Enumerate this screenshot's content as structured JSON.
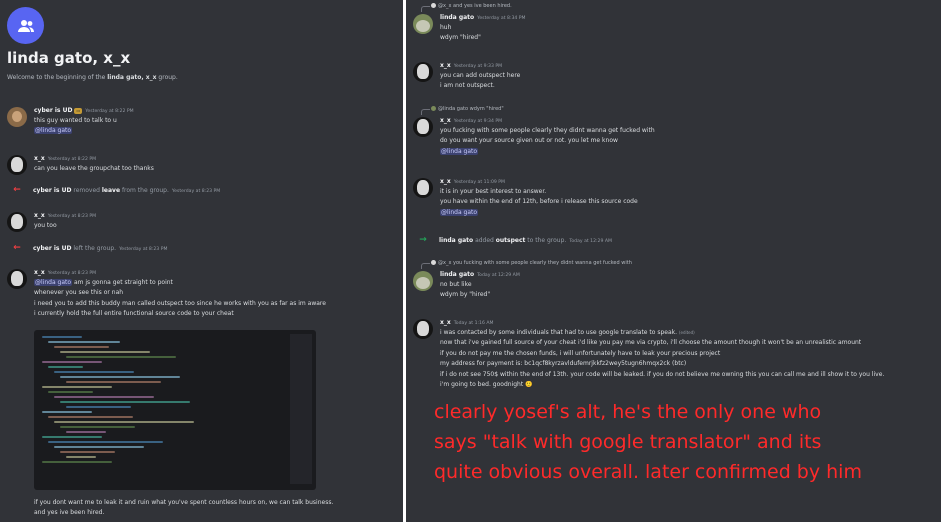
{
  "group": {
    "title": "linda gato, x_x",
    "welcome_prefix": "Welcome to the beginning of the ",
    "welcome_name": "linda gato, x_x",
    "welcome_suffix": " group."
  },
  "left_messages": [
    {
      "author": "cyber is UD",
      "tag": "▭",
      "time": "Yesterday at 8:22 PM",
      "lines": [
        "this guy wanted to talk to u"
      ],
      "mention": "@linda gato"
    },
    {
      "author": "x_x",
      "time": "Yesterday at 8:22 PM",
      "lines": [
        "can you leave the groupchat too thanks"
      ]
    },
    {
      "author": "x_x",
      "time": "Yesterday at 8:23 PM",
      "lines": [
        "you too"
      ]
    },
    {
      "author": "x_x",
      "time": "Yesterday at 8:23 PM",
      "mention": "@linda gato",
      "lines": [
        " am js gonna get straight to point",
        "whenever you see this or nah",
        "i need you to add this buddy man called outspect too since he works with you as far as im aware",
        "i currently hold the full entire functional source code to your cheat"
      ],
      "after": [
        "if you dont want me to leak it and ruin what you've spent countless hours on, we can talk business.",
        "and yes ive been hired."
      ]
    }
  ],
  "left_system": [
    {
      "name": "cyber is UD",
      "text1": " removed ",
      "strong": "leave",
      "text2": " from the group.",
      "time": "Yesterday at 8:23 PM"
    },
    {
      "name": "cyber is UD",
      "text1": " left the group.",
      "time": "Yesterday at 8:23 PM"
    }
  ],
  "right_messages": [
    {
      "reply": "@x_x and yes ive been hired.",
      "author": "linda gato",
      "time": "Yesterday at 8:34 PM",
      "lines": [
        "huh",
        "wdym \"hired\""
      ]
    },
    {
      "author": "x_x",
      "time": "Yesterday at 9:33 PM",
      "lines": [
        "you can add outspect here",
        "i am not outspect."
      ]
    },
    {
      "reply": "@linda gato wdym \"hired\"",
      "author": "x_x",
      "time": "Yesterday at 9:34 PM",
      "lines": [
        "you fucking with some people clearly they didnt wanna get fucked with",
        "do you want your source given out or not. you let me know"
      ],
      "mention": "@linda gato"
    },
    {
      "author": "x_x",
      "time": "Yesterday at 11:09 PM",
      "lines": [
        "it is in your best interest to answer.",
        "you have within the end of 12th, before i release this source code"
      ],
      "mention": "@linda gato"
    },
    {
      "reply": "@x_x you fucking with some people clearly they didnt wanna get fucked with",
      "author": "linda gato",
      "time": "Today at 12:29 AM",
      "lines": [
        "no but like",
        "wdym by \"hired\""
      ]
    },
    {
      "author": "x_x",
      "time": "Today at 1:16 AM",
      "lines": [
        "i was contacted by some individuals that had to use google translate to speak.",
        "now that i've gained full source of your cheat i'd like you pay me via crypto, i'll choose the amount though it won't be an unrealistic amount",
        "if you do not pay me the chosen funds, i will unfortunately have to leak your precious project",
        "my address for payment is: bc1qcf8kyrzavldufemrjkkfz2wey5tugn6hmqx2ck (btc)",
        "if i do not see 750$ within the end of 13th. your code will be leaked. if you do not believe me owning this you can call me and ill show it to you live.",
        "i'm going to bed. goodnight 🙂"
      ],
      "edited": "(edited)"
    }
  ],
  "right_system": {
    "name": "linda gato",
    "text1": " added ",
    "strong": "outspect",
    "text2": " to the group.",
    "time": "Today at 12:29 AM"
  },
  "caption": [
    "clearly yosef's alt, he's the only one who",
    "says \"talk with google translator\" and its",
    "quite obvious overall. later confirmed by him"
  ],
  "colors": {
    "background": "#313338",
    "mention_bg": "#3c4270",
    "caption": "#ff2a2a",
    "leave_arrow": "#f23f42",
    "join_arrow": "#23a55a",
    "accent": "#5865f2"
  },
  "icons": {
    "group": "users-icon",
    "leave": "arrow-left-icon",
    "join": "arrow-right-icon"
  }
}
